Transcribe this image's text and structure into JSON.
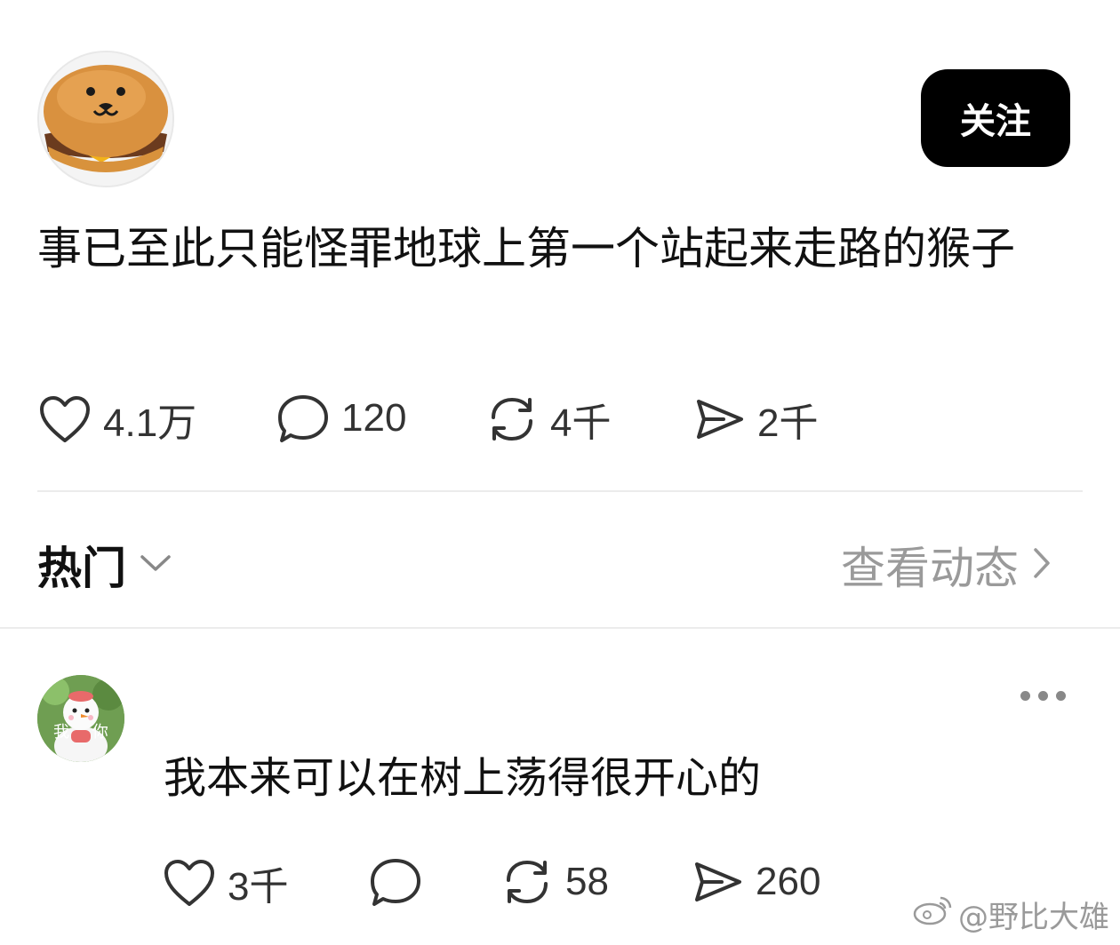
{
  "post": {
    "follow_label": "关注",
    "text": "事已至此只能怪罪地球上第一个站起来走路的猴子",
    "stats": {
      "likes": "4.1万",
      "comments": "120",
      "reposts": "4千",
      "shares": "2千"
    }
  },
  "section": {
    "hot_label": "热门",
    "view_label": "查看动态"
  },
  "comment": {
    "avatar_text": "我 你",
    "text": "我本来可以在树上荡得很开心的",
    "stats": {
      "likes": "3千",
      "comments": "",
      "reposts": "58",
      "shares": "260"
    }
  },
  "watermark": "@野比大雄",
  "icons": [
    "heart-icon",
    "comment-icon",
    "repost-icon",
    "share-icon",
    "chevron-down-icon",
    "chevron-right-icon",
    "more-icon",
    "weibo-icon"
  ],
  "colors": {
    "follow_bg": "#000000",
    "muted_text": "#9a9a9a",
    "divider": "#ececec"
  }
}
